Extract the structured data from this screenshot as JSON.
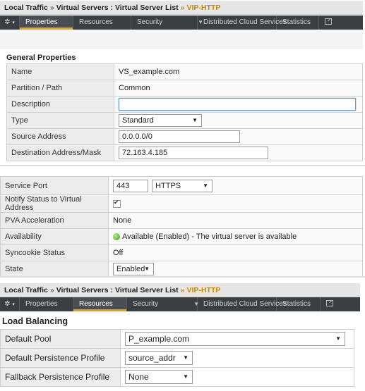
{
  "panel1": {
    "breadcrumb": [
      "Local Traffic",
      "Virtual Servers : Virtual Server List",
      "VIP-HTTP"
    ],
    "tabs": [
      {
        "label": "Properties",
        "active": true
      },
      {
        "label": "Resources",
        "active": false
      },
      {
        "label": "Security",
        "active": false
      },
      {
        "label": "Distributed Cloud Services",
        "active": false
      },
      {
        "label": "Statistics",
        "active": false
      }
    ],
    "section_title": "General Properties",
    "rows": {
      "name": {
        "label": "Name",
        "value": "VS_example.com"
      },
      "partition": {
        "label": "Partition / Path",
        "value": "Common"
      },
      "description": {
        "label": "Description",
        "value": ""
      },
      "type": {
        "label": "Type",
        "value": "Standard"
      },
      "source": {
        "label": "Source Address",
        "value": "0.0.0.0/0"
      },
      "destination": {
        "label": "Destination Address/Mask",
        "value": "72.163.4.185"
      }
    }
  },
  "panel2": {
    "rows": {
      "service_port": {
        "label": "Service Port",
        "port": "443",
        "protocol": "HTTPS"
      },
      "notify": {
        "label": "Notify Status to Virtual Address",
        "checked": true
      },
      "pva": {
        "label": "PVA Acceleration",
        "value": "None"
      },
      "availability": {
        "label": "Availability",
        "value": "Available (Enabled) - The virtual server is available"
      },
      "syncookie": {
        "label": "Syncookie Status",
        "value": "Off"
      },
      "state": {
        "label": "State",
        "value": "Enabled"
      }
    }
  },
  "panel3": {
    "breadcrumb": [
      "Local Traffic",
      "Virtual Servers : Virtual Server List",
      "VIP-HTTP"
    ],
    "tabs": [
      {
        "label": "Properties",
        "active": false
      },
      {
        "label": "Resources",
        "active": true
      },
      {
        "label": "Security",
        "active": false
      },
      {
        "label": "Distributed Cloud Services",
        "active": false
      },
      {
        "label": "Statistics",
        "active": false
      }
    ],
    "section_title": "Load Balancing",
    "rows": {
      "default_pool": {
        "label": "Default Pool",
        "value": "P_example.com"
      },
      "default_persistence": {
        "label": "Default Persistence Profile",
        "value": "source_addr"
      },
      "fallback_persistence": {
        "label": "Fallback Persistence Profile",
        "value": "None"
      }
    }
  },
  "colors": {
    "accent": "#f0a000",
    "breadcrumb_current": "#c98a00",
    "tabbar": "#3b3f42"
  },
  "icons": {
    "gear": "gear-icon",
    "external": "external-window-icon",
    "status": "green-status-icon"
  }
}
